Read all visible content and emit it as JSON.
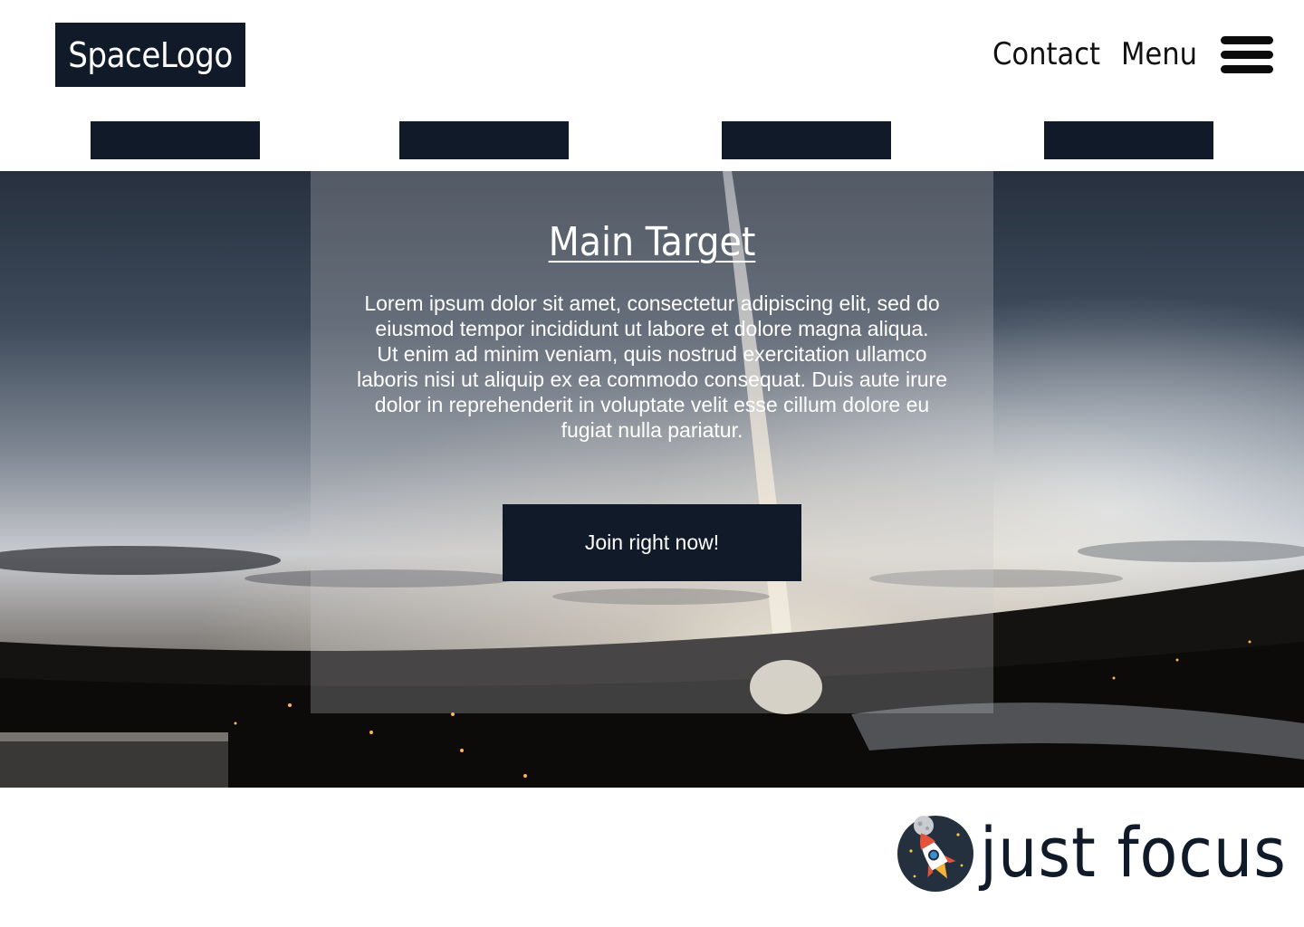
{
  "header": {
    "logo_text": "SpaceLogo",
    "nav": {
      "contact": "Contact",
      "menu": "Menu"
    },
    "hamburger_icon": "hamburger-menu-icon"
  },
  "subnav": {
    "item_count": 4,
    "color": "#111a28"
  },
  "hero": {
    "background": "rocket-launch-photo",
    "title": "Main Target",
    "paragraph_1": "Lorem ipsum dolor sit amet, consectetur adipiscing elit, sed do eiusmod tempor incididunt ut labore et dolore magna aliqua.",
    "paragraph_2": "Ut enim ad minim veniam, quis nostrud exercitation ullamco laboris nisi ut aliquip ex ea commodo consequat. Duis aute irure dolor in reprehenderit in voluptate velit esse cillum dolore eu fugiat nulla pariatur.",
    "cta_label": "Join right now!"
  },
  "footer": {
    "brand_icon": "rocket-moon-icon",
    "brand_text": "just focus"
  },
  "colors": {
    "dark_navy": "#111a28",
    "white": "#ffffff"
  }
}
